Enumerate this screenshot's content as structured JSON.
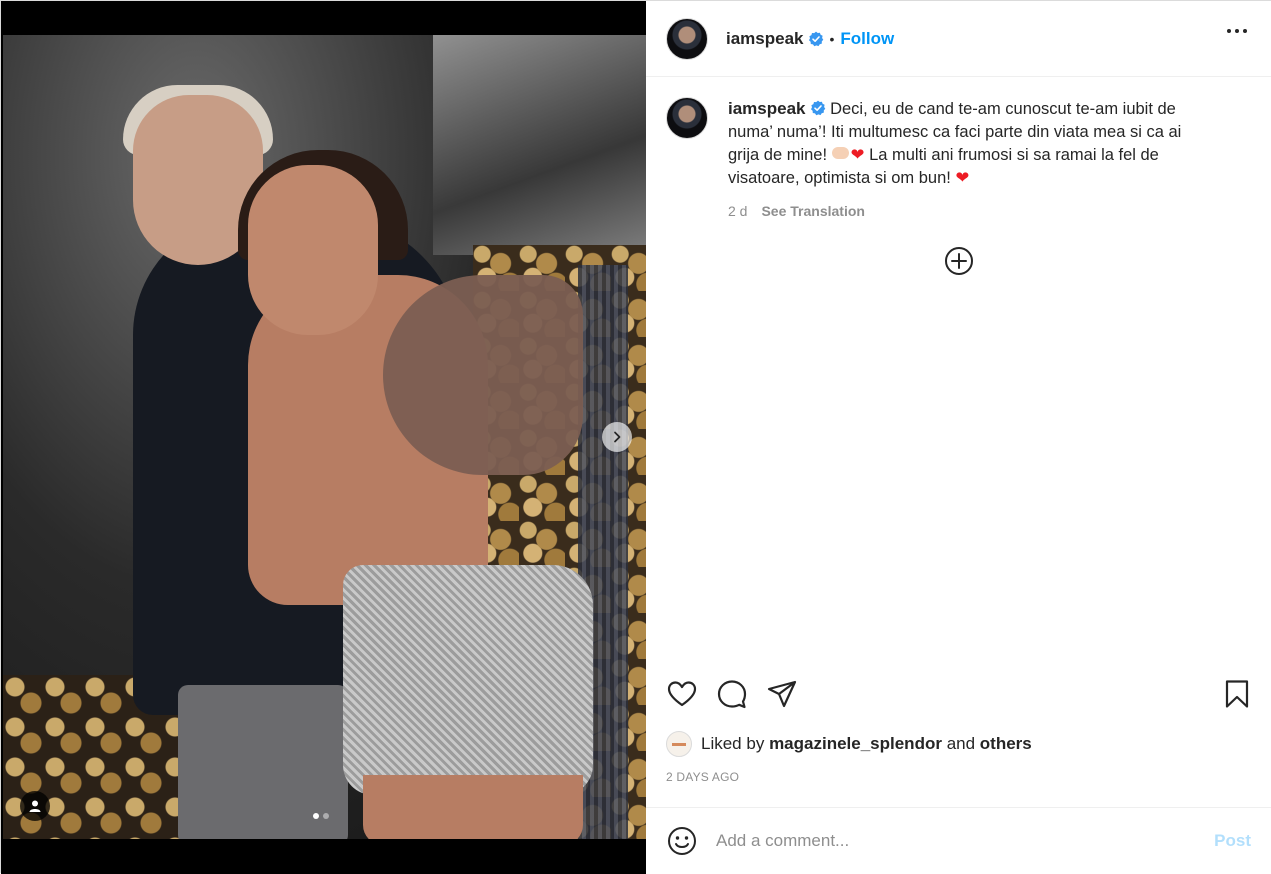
{
  "post": {
    "username": "iamspeak",
    "follow_label": "Follow",
    "separator": "•",
    "caption_line1": "Deci, eu de cand te-am cunoscut te-am iubit de numa’ numa’! Iti multumesc ca faci parte din viata mea si ca ai grija de mine!",
    "caption_line2": "La multi ani frumosi si sa ramai la fel de visatoare, optimista si om bun!",
    "time_ago": "2 d",
    "see_translation": "See Translation",
    "liked_by_prefix": "Liked by",
    "liked_by_user": "magazinele_splendor",
    "liked_by_and": "and",
    "liked_by_others": "others",
    "date_label": "2 DAYS AGO",
    "comment_placeholder": "Add a comment...",
    "post_label": "Post",
    "carousel_count": 2,
    "carousel_active": 1
  },
  "colors": {
    "accent": "#0095f6",
    "post_disabled": "#b2dffc",
    "heart": "#ed1c24",
    "muted": "#8e8e8e"
  },
  "icons": {
    "verified": "verified-badge-icon",
    "more": "more-horizontal-icon",
    "like": "heart-outline-icon",
    "comment": "comment-bubble-icon",
    "share": "paper-plane-icon",
    "save": "bookmark-icon",
    "emoji": "emoji-smile-icon",
    "load_more": "plus-circle-icon",
    "next": "chevron-right-icon",
    "tag": "user-tag-icon"
  }
}
